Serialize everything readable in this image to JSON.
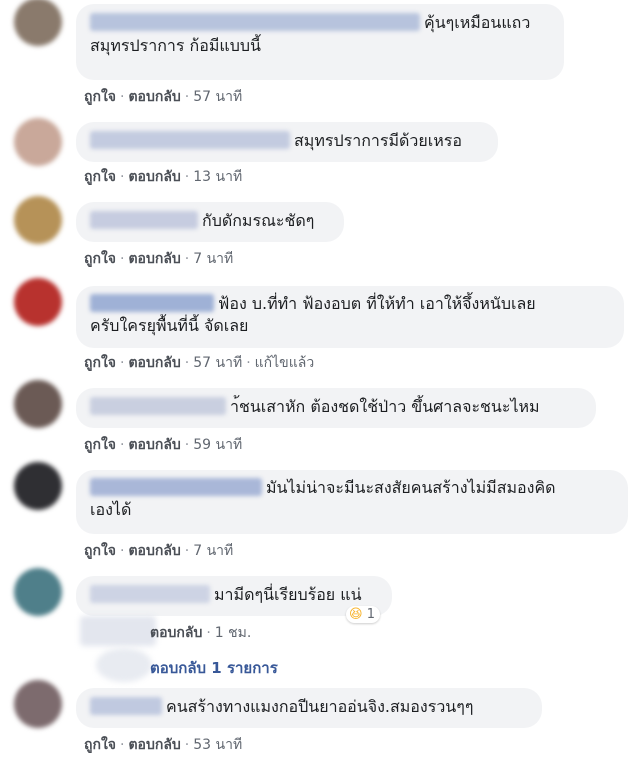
{
  "comments": [
    {
      "text_line1": "คุ้นๆเหมือนแถว",
      "text_line2": "สมุทรปราการ ก้อมีแบบนี้",
      "like": "ถูกใจ",
      "reply": "ตอบกลับ",
      "time": "57 นาที",
      "avatar_color": "#8a7a6c"
    },
    {
      "text_line1": "สมุทรปราการมีด้วยเหรอ",
      "like": "ถูกใจ",
      "reply": "ตอบกลับ",
      "time": "13 นาที",
      "avatar_color": "#c9a89a"
    },
    {
      "text_line1": "กับดักมรณะชัดๆ",
      "like": "ถูกใจ",
      "reply": "ตอบกลับ",
      "time": "7 นาที",
      "avatar_color": "#b69258"
    },
    {
      "text_line1": "ฟ้อง บ.ที่ทำ ฟ้องอบต ที่ให้ทำ เอาให้จึ้งหนับเลย",
      "text_line2": "ครับใครยุพื้นที่นี้ จัดเลย",
      "like": "ถูกใจ",
      "reply": "ตอบกลับ",
      "time": "57 นาที",
      "edited": "แก้ไขแล้ว",
      "avatar_color": "#b8322e"
    },
    {
      "text_line1": "า้ชนเสาหัก ต้องชดใช้ป่าว ขึ้นศาลจะชนะไหม",
      "like": "ถูกใจ",
      "reply": "ตอบกลับ",
      "time": "59 นาที",
      "avatar_color": "#6b5a55"
    },
    {
      "text_line1": "มันไม่น่าจะมีนะสงสัยคนสร้างไม่มีสมองคิด",
      "text_line2": "เองได้",
      "like": "ถูกใจ",
      "reply": "ตอบกลับ",
      "time": "7 นาที",
      "avatar_color": "#2f2f33"
    },
    {
      "text_line1": "มามีดๆนี่เรียบร้อย แน่",
      "reply": "ตอบกลับ",
      "time": "1 ชม.",
      "reaction_icon": "laughing-emoji",
      "reaction_glyph": "😆",
      "reaction_count": "1",
      "avatar_color": "#4f7f8a"
    },
    {
      "text_line1": "คนสร้างทางแมงกอปีนยาออ่นจิง.สมองรวนๆๆ",
      "like": "ถูกใจ",
      "reply": "ตอบกลับ",
      "time": "53 นาที",
      "avatar_color": "#7d6b6e"
    }
  ],
  "replies_link": "ตอบกลับ 1 รายการ",
  "separator": "·",
  "colors": {
    "bubble": "#f2f3f5",
    "link": "#385898",
    "action": "#4b4f56"
  }
}
